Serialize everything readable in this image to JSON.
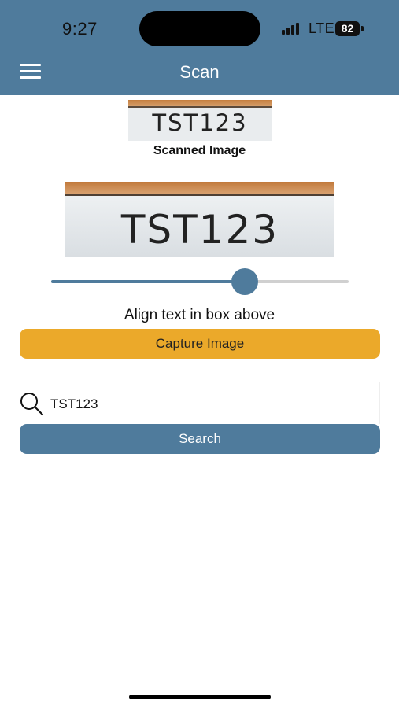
{
  "status_bar": {
    "time": "9:27",
    "network": "LTE",
    "battery": "82"
  },
  "header": {
    "title": "Scan",
    "menu_icon": "hamburger-menu-icon"
  },
  "scanned_image": {
    "plate_text": "TST123",
    "caption": "Scanned Image"
  },
  "preview": {
    "plate_text": "TST123"
  },
  "slider": {
    "value": 0.65
  },
  "instructions": "Align text in box above",
  "capture_button": {
    "label": "Capture Image"
  },
  "search": {
    "icon": "search-icon",
    "value": "TST123",
    "button_label": "Search"
  },
  "colors": {
    "primary": "#4f7b9c",
    "accent": "#eba92a",
    "plate_rust": "#c9864a"
  }
}
